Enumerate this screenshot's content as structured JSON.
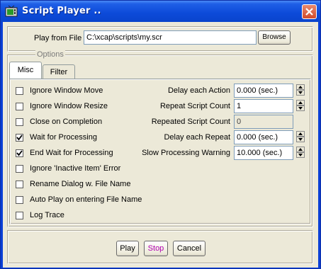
{
  "window": {
    "title": "Script Player ..",
    "icon": "script-player-app-icon",
    "close_icon": "close-icon"
  },
  "top": {
    "play_from_file_label": "Play from File",
    "file_path": "C:\\xcap\\scripts\\my.scr",
    "browse_label": "Browse"
  },
  "options": {
    "title": "Options",
    "tabs": [
      {
        "label": "Misc",
        "selected": true
      },
      {
        "label": "Filter",
        "selected": false
      }
    ],
    "checkboxes": [
      {
        "label": "Ignore Window Move",
        "checked": false
      },
      {
        "label": "Ignore Window Resize",
        "checked": false
      },
      {
        "label": "Close on Completion",
        "checked": false
      },
      {
        "label": "Wait for Processing",
        "checked": true
      },
      {
        "label": "End Wait for Processing",
        "checked": true
      },
      {
        "label": "Ignore 'Inactive Item' Error",
        "checked": false
      },
      {
        "label": "Rename Dialog w. File Name",
        "checked": false
      },
      {
        "label": "Auto Play on entering File Name",
        "checked": false
      },
      {
        "label": "Log Trace",
        "checked": false
      }
    ],
    "fields": {
      "delay_each_action": {
        "label": "Delay each Action",
        "value": "0.000 (sec.)"
      },
      "repeat_script_count": {
        "label": "Repeat Script Count",
        "value": "1"
      },
      "repeated_script_count": {
        "label": "Repeated Script Count",
        "value": "0"
      },
      "delay_each_repeat": {
        "label": "Delay each Repeat",
        "value": "0.000 (sec.)"
      },
      "slow_processing_warning": {
        "label": "Slow Processing Warning",
        "value": "10.000 (sec.)"
      }
    }
  },
  "buttons": {
    "play": "Play",
    "stop": "Stop",
    "cancel": "Cancel"
  },
  "colors": {
    "titlebar": "#0a44cc",
    "stop_text": "#b000b0",
    "face": "#ece9d8"
  }
}
